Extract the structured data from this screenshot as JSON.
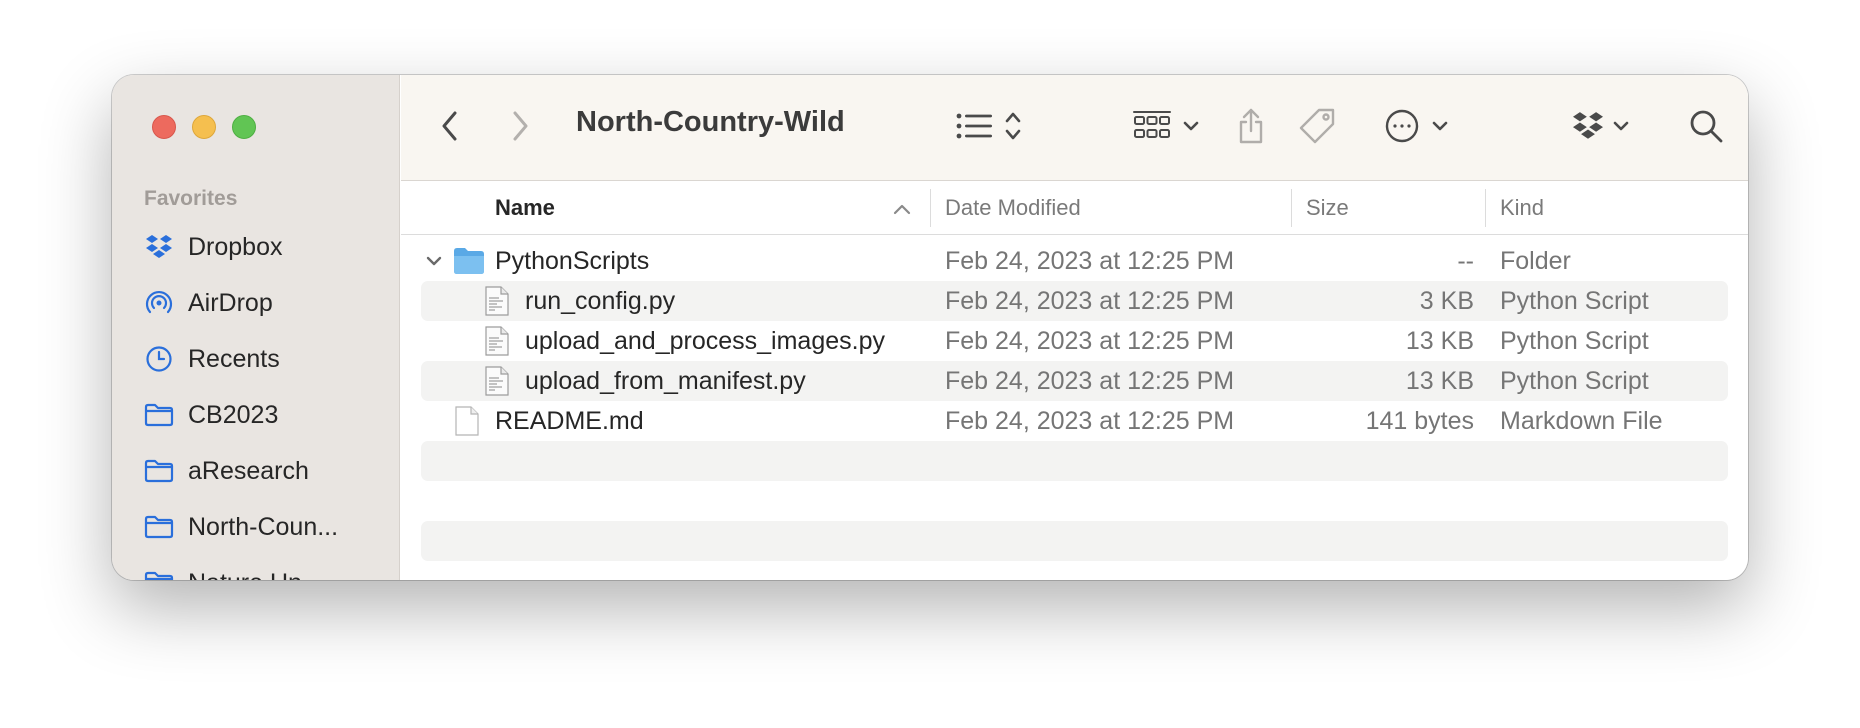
{
  "window": {
    "title": "North-Country-Wild"
  },
  "sidebar": {
    "heading": "Favorites",
    "items": [
      {
        "label": "Dropbox",
        "icon": "dropbox-icon"
      },
      {
        "label": "AirDrop",
        "icon": "airdrop-icon"
      },
      {
        "label": "Recents",
        "icon": "clock-icon"
      },
      {
        "label": "CB2023",
        "icon": "folder-icon"
      },
      {
        "label": "aResearch",
        "icon": "folder-icon"
      },
      {
        "label": "North-Coun...",
        "icon": "folder-icon"
      },
      {
        "label": "Nature Un...",
        "icon": "folder-icon"
      }
    ]
  },
  "columns": {
    "name": "Name",
    "date": "Date Modified",
    "size": "Size",
    "kind": "Kind"
  },
  "rows": [
    {
      "name": "PythonScripts",
      "date": "Feb 24, 2023 at 12:25 PM",
      "size": "--",
      "kind": "Folder",
      "icon": "folder-icon",
      "expanded": true
    },
    {
      "name": "run_config.py",
      "date": "Feb 24, 2023 at 12:25 PM",
      "size": "3 KB",
      "kind": "Python Script",
      "icon": "python-file-icon"
    },
    {
      "name": "upload_and_process_images.py",
      "date": "Feb 24, 2023 at 12:25 PM",
      "size": "13 KB",
      "kind": "Python Script",
      "icon": "python-file-icon"
    },
    {
      "name": "upload_from_manifest.py",
      "date": "Feb 24, 2023 at 12:25 PM",
      "size": "13 KB",
      "kind": "Python Script",
      "icon": "python-file-icon"
    },
    {
      "name": "README.md",
      "date": "Feb 24, 2023 at 12:25 PM",
      "size": "141 bytes",
      "kind": "Markdown File",
      "icon": "document-icon"
    }
  ],
  "colors": {
    "accent": "#2a6fdb",
    "close": "#ed6a5e",
    "minimize": "#f5bf4f",
    "zoom": "#61c554"
  }
}
